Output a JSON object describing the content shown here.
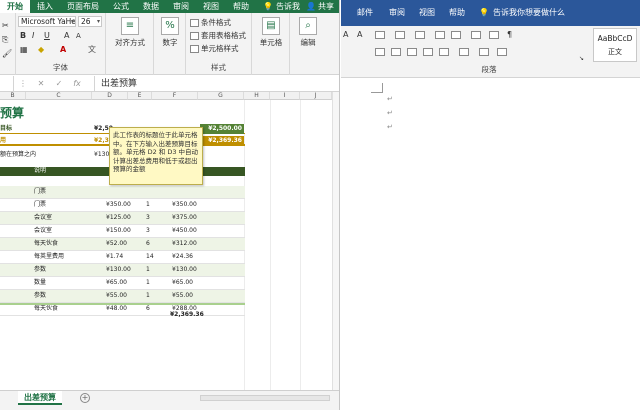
{
  "excel": {
    "tabs": [
      "开始",
      "插入",
      "页面布局",
      "公式",
      "数据",
      "审阅",
      "视图",
      "帮助",
      "告诉我"
    ],
    "share": "共享",
    "font": {
      "name": "Microsoft YaHei",
      "size": "26",
      "group_label": "字体"
    },
    "groups": {
      "alignment": "对齐方式",
      "number": "数字",
      "styles_label": "样式",
      "conditional": "条件格式",
      "table_format": "套用表格格式",
      "cell_styles": "单元格样式",
      "cells": "单元格",
      "editing": "编辑"
    },
    "formula_bar": {
      "value": "出差预算"
    },
    "columns": [
      "B",
      "C",
      "D",
      "E",
      "F",
      "G",
      "H",
      "I",
      "J"
    ],
    "sheet": {
      "title": "预算",
      "band1_label": "目标",
      "band1_value": "¥2,50",
      "band1_right": "¥2,500.00",
      "band2_label": "用",
      "band2_value": "¥2,3",
      "band2_right": "¥2,369.36",
      "note_label": "额在预算之内",
      "note_value": "¥130.6",
      "header_label": "说明",
      "rows": [
        {
          "label": "门票",
          "price": "",
          "qty": "",
          "total": ""
        },
        {
          "label": "门票",
          "price": "¥350.00",
          "qty": "1",
          "total": "¥350.00"
        },
        {
          "label": "会议室",
          "price": "¥125.00",
          "qty": "3",
          "total": "¥375.00"
        },
        {
          "label": "会议室",
          "price": "¥150.00",
          "qty": "3",
          "total": "¥450.00"
        },
        {
          "label": "每天伙食",
          "price": "¥52.00",
          "qty": "6",
          "total": "¥312.00"
        },
        {
          "label": "每英里费用",
          "price": "¥1.74",
          "qty": "14",
          "total": "¥24.36"
        },
        {
          "label": "参数",
          "price": "¥130.00",
          "qty": "1",
          "total": "¥130.00"
        },
        {
          "label": "数量",
          "price": "¥65.00",
          "qty": "1",
          "total": "¥65.00"
        },
        {
          "label": "参数",
          "price": "¥55.00",
          "qty": "1",
          "total": "¥55.00"
        },
        {
          "label": "每天伙食",
          "price": "¥48.00",
          "qty": "6",
          "total": "¥288.00"
        }
      ],
      "grand_total": "¥2,369.36"
    },
    "tooltip": "此工作表的标题位于此单元格中。在下方输入出差预算目标额。单元格 D2 和 D3 中自动计算出差总费用和低于或超出预算的金额",
    "sheet_tab": "出差预算"
  },
  "word": {
    "tabs": [
      "邮件",
      "审阅",
      "视图",
      "帮助",
      "告诉我你想要做什么"
    ],
    "style_sample": "AaBbCcD",
    "style_name": "正文",
    "paragraph_label": "段落",
    "paragraph_mark": "↵"
  },
  "colors": {
    "excel_green": "#217346",
    "word_blue": "#2b579a",
    "header_dark": "#375623",
    "band_gold": "#bf8f00"
  }
}
